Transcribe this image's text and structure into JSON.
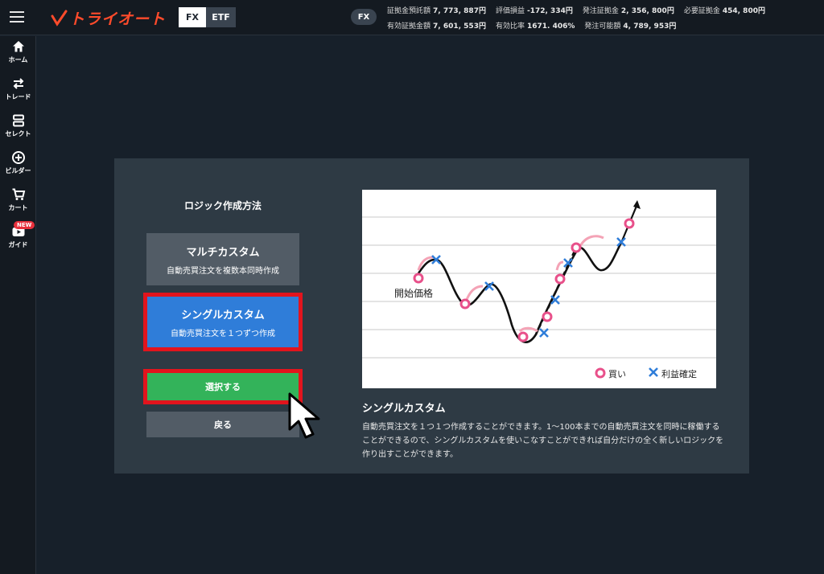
{
  "header": {
    "logo_text": "トライオート",
    "tabs": [
      {
        "label": "FX",
        "active": true
      },
      {
        "label": "ETF",
        "active": false
      }
    ],
    "market_pill": "FX",
    "stats_row1": [
      {
        "label": "証拠金預託額",
        "value": "7, 773, 887円"
      },
      {
        "label": "評価損益",
        "value": "-172, 334円"
      },
      {
        "label": "発注証拠金",
        "value": "2, 356, 800円"
      },
      {
        "label": "必要証拠金",
        "value": "454, 800円"
      }
    ],
    "stats_row2": [
      {
        "label": "有効証拠金額",
        "value": "7, 601, 553円"
      },
      {
        "label": "有効比率",
        "value": "1671. 406%"
      },
      {
        "label": "発注可能額",
        "value": "4, 789, 953円"
      }
    ]
  },
  "sidebar": {
    "items": [
      {
        "label": "ホーム",
        "icon": "home-icon"
      },
      {
        "label": "トレード",
        "icon": "trade-icon"
      },
      {
        "label": "セレクト",
        "icon": "select-icon"
      },
      {
        "label": "ビルダー",
        "icon": "builder-icon"
      },
      {
        "label": "カート",
        "icon": "cart-icon"
      },
      {
        "label": "ガイド",
        "icon": "guide-icon",
        "badge": "NEW"
      }
    ]
  },
  "modal": {
    "title": "ロジック作成方法",
    "options": [
      {
        "title": "マルチカスタム",
        "subtitle": "自動売買注文を複数本同時作成"
      },
      {
        "title": "シングルカスタム",
        "subtitle": "自動売買注文を１つずつ作成"
      }
    ],
    "select_label": "選択する",
    "back_label": "戻る",
    "chart": {
      "start_label": "開始価格",
      "legend_buy": "買い",
      "legend_profit": "利益確定"
    },
    "description_title": "シングルカスタム",
    "description_body": "自動売買注文を１つ１つ作成することができます。1～100本までの自動売買注文を同時に稼働することができるので、シングルカスタムを使いこなすことができれば自分だけの全く新しいロジックを作り出すことができます。"
  },
  "colors": {
    "accent_red": "#e2141d",
    "single_blue": "#2f7dd9",
    "select_green": "#33b35a",
    "logo_orange": "#ff4b2b",
    "buy_pink": "#e8508a",
    "profit_blue": "#2f7dd9"
  }
}
